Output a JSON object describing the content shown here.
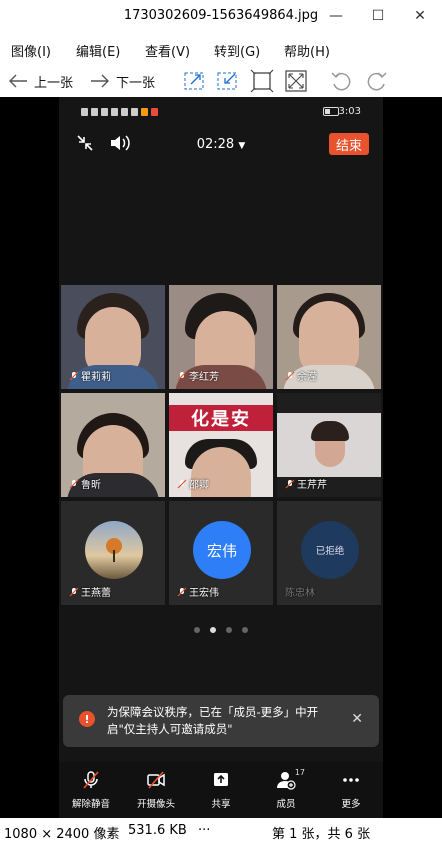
{
  "window": {
    "title": "1730302609-1563649864.jpg",
    "minimize": "—",
    "maximize": "☐",
    "close": "✕"
  },
  "menu": [
    "图像(I)",
    "编辑(E)",
    "查看(V)",
    "转到(G)",
    "帮助(H)"
  ],
  "toolbar": {
    "prev_label": "上一张",
    "next_label": "下一张"
  },
  "phone": {
    "status_time": "3:03",
    "duration": "02:28",
    "end_label": "结束",
    "participants": [
      {
        "name": "瞿莉莉",
        "type": "video"
      },
      {
        "name": "李红芳",
        "type": "video"
      },
      {
        "name": "余滢",
        "type": "video"
      },
      {
        "name": "鲁昕",
        "type": "video"
      },
      {
        "name": "邵卿",
        "type": "video",
        "banner": "化是安"
      },
      {
        "name": "王芹芹",
        "type": "video"
      },
      {
        "name": "王燕蕾",
        "type": "avatar"
      },
      {
        "name": "王宏伟",
        "type": "avatar",
        "avatar_text": "宏伟"
      },
      {
        "name": "陈忠林",
        "type": "declined",
        "status": "已拒绝"
      }
    ],
    "pages": {
      "count": 4,
      "active": 2
    },
    "toast": {
      "message": "为保障会议秩序，已在「成员-更多」中开启\"仅主持人可邀请成员\"",
      "close": "✕"
    },
    "bottom_bar": [
      {
        "label": "解除静音",
        "icon": "mic-off-icon"
      },
      {
        "label": "开摄像头",
        "icon": "camera-off-icon"
      },
      {
        "label": "共享",
        "icon": "share-icon"
      },
      {
        "label": "成员",
        "icon": "members-icon",
        "badge": "17"
      },
      {
        "label": "更多",
        "icon": "more-icon"
      }
    ]
  },
  "statusbar": {
    "dimensions": "1080 × 2400 像素",
    "size": "531.6 KB",
    "ellipsis": "···",
    "page": "第 1 张，共 6 张"
  },
  "colors": {
    "accent": "#e8532d",
    "phone_bg": "#151515",
    "tile_bg": "#2a2a2a",
    "avatar_blue": "#2d7ef7",
    "avatar_declined": "#1f3a5f"
  }
}
